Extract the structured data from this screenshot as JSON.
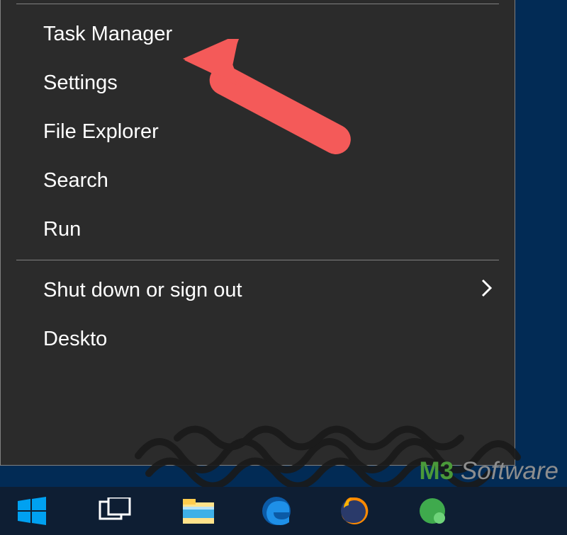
{
  "menu": {
    "group1": [
      {
        "label": "Task Manager"
      },
      {
        "label": "Settings"
      },
      {
        "label": "File Explorer"
      },
      {
        "label": "Search"
      },
      {
        "label": "Run"
      }
    ],
    "group2": [
      {
        "label": "Shut down or sign out",
        "submenu": true
      },
      {
        "label": "Deskto",
        "submenu": false
      }
    ]
  },
  "annotation": {
    "arrow_target": "Task Manager",
    "arrow_color": "#f45a59"
  },
  "watermark": {
    "brand_left": "M",
    "brand_num": "3",
    "brand_right": " Software",
    "brand_left_color": "#4a9a3a",
    "brand_num_color": "#4a9a3a",
    "brand_right_color": "#8e8e8e"
  },
  "taskbar": {
    "items": [
      {
        "name": "start-button"
      },
      {
        "name": "task-view-button"
      },
      {
        "name": "file-explorer-pinned"
      },
      {
        "name": "microsoft-edge-pinned"
      },
      {
        "name": "firefox-pinned"
      },
      {
        "name": "unknown-pinned"
      }
    ]
  }
}
